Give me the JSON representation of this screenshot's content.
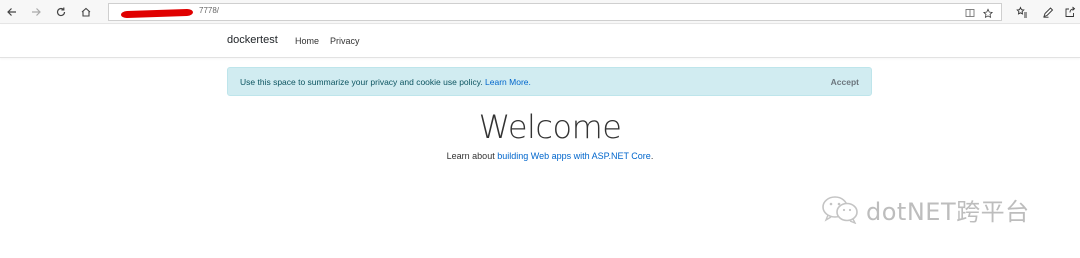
{
  "browser": {
    "address_text": "7778/",
    "icons": [
      "back-icon",
      "forward-icon",
      "refresh-icon",
      "home-icon",
      "reading-view-icon",
      "favorite-star-icon",
      "favorites-hub-icon",
      "notes-pen-icon",
      "share-icon"
    ]
  },
  "site_nav": {
    "brand": "dockertest",
    "links": [
      {
        "label": "Home"
      },
      {
        "label": "Privacy"
      }
    ]
  },
  "cookie_alert": {
    "message": "Use this space to summarize your privacy and cookie use policy.",
    "link_text": "Learn More.",
    "accept_label": "Accept",
    "bg_color": "#d1ecf1"
  },
  "main": {
    "title": "Welcome",
    "learn_prefix": "Learn about",
    "learn_link": "building Web apps with ASP.NET Core",
    "learn_suffix": "."
  },
  "watermark": {
    "text": "dotNET跨平台"
  }
}
